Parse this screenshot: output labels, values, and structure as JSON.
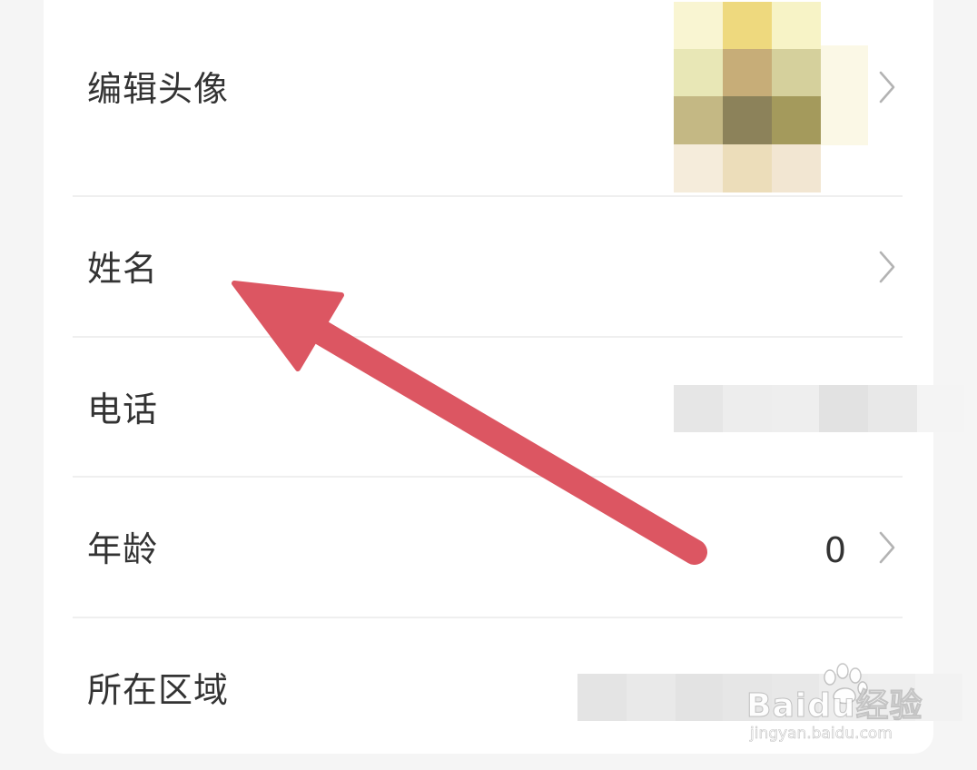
{
  "profile": {
    "rows": [
      {
        "label": "编辑头像"
      },
      {
        "label": "姓名"
      },
      {
        "label": "电话"
      },
      {
        "label": "年龄",
        "value": "0"
      },
      {
        "label": "所在区域"
      }
    ]
  },
  "icons": {
    "chevron": "chevron-right-icon",
    "arrow": "red-arrow-annotation"
  },
  "colors": {
    "background": "#f5f5f5",
    "card": "#ffffff",
    "text": "#333333",
    "chevron": "#b3b3b3",
    "annotation_arrow": "#dc5662"
  },
  "watermark": {
    "brand": "Baidu经验",
    "url": "jingyan.baidu.com"
  }
}
